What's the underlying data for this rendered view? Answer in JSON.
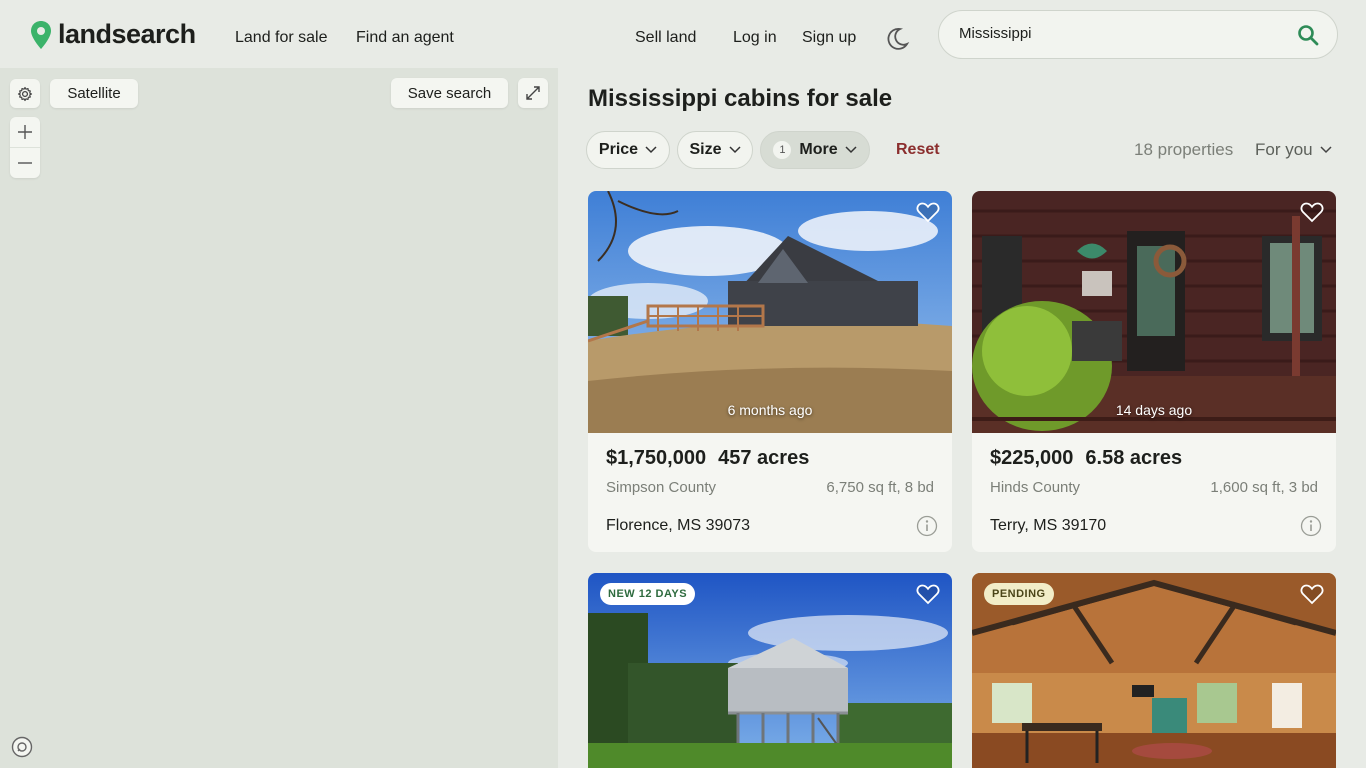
{
  "header": {
    "logo_text": "landsearch",
    "nav": {
      "land_for_sale": "Land for sale",
      "find_agent": "Find an agent",
      "sell_land": "Sell land",
      "log_in": "Log in",
      "sign_up": "Sign up"
    },
    "search": {
      "value": "Mississippi"
    }
  },
  "map": {
    "satellite_label": "Satellite",
    "save_search_label": "Save search"
  },
  "listings": {
    "title": "Mississippi cabins for sale",
    "filters": {
      "price": "Price",
      "size": "Size",
      "more": "More",
      "more_count": "1",
      "reset": "Reset"
    },
    "count_text": "18 properties",
    "sort_label": "For you",
    "cards": [
      {
        "age": "6 months ago",
        "price": "$1,750,000",
        "acres": "457 acres",
        "county": "Simpson County",
        "specs": "6,750 sq ft, 8 bd",
        "city": "Florence, MS 39073"
      },
      {
        "age": "14 days ago",
        "price": "$225,000",
        "acres": "6.58 acres",
        "county": "Hinds County",
        "specs": "1,600 sq ft, 3 bd",
        "city": "Terry, MS 39170"
      },
      {
        "badge": "NEW  12 DAYS"
      },
      {
        "badge": "PENDING"
      }
    ]
  },
  "colors": {
    "brand_green": "#3bb36a",
    "reset_red": "#8b2e2e",
    "background": "#e8ebe6"
  }
}
